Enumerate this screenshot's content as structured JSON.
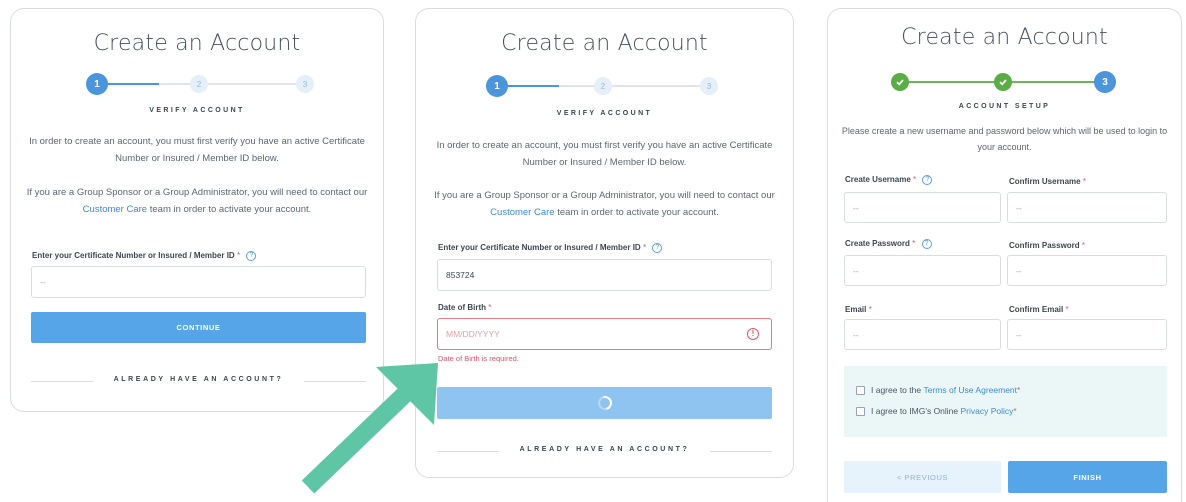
{
  "card1": {
    "title": "Create an Account",
    "steps": [
      "1",
      "2",
      "3"
    ],
    "step_label": "VERIFY ACCOUNT",
    "intro": "In order to create an account, you must first verify you have an active Certificate Number or Insured / Member ID below.",
    "sponsor_text_before": "If you are a Group Sponsor or a Group Administrator, you will need to contact our",
    "customer_care_link": "Customer Care",
    "sponsor_text_after": "team in order to activate your account.",
    "id_label": "Enter your Certificate Number or Insured / Member ID",
    "id_placeholder": "--",
    "continue_label": "CONTINUE",
    "already_label": "ALREADY HAVE AN ACCOUNT?"
  },
  "card2": {
    "title": "Create an Account",
    "steps": [
      "1",
      "2",
      "3"
    ],
    "step_label": "VERIFY ACCOUNT",
    "intro": "In order to create an account, you must first verify you have an active Certificate Number or Insured / Member ID below.",
    "sponsor_text_before": "If you are a Group Sponsor or a Group Administrator, you will need to contact our",
    "customer_care_link": "Customer Care",
    "sponsor_text_after": "team in order to activate your account.",
    "id_label": "Enter your Certificate Number or Insured / Member ID",
    "id_value": "853724",
    "dob_label": "Date of Birth",
    "dob_placeholder": "MM/DD/YYYY",
    "dob_error": "Date of Birth is required.",
    "error_icon_glyph": "!",
    "already_label": "ALREADY HAVE AN ACCOUNT?"
  },
  "card3": {
    "title": "Create an Account",
    "steps": [
      "",
      "",
      "3"
    ],
    "step_label": "ACCOUNT SETUP",
    "intro": "Please create a new username and password below which will be used to login to your account.",
    "create_username_label": "Create Username",
    "confirm_username_label": "Confirm Username",
    "create_password_label": "Create Password",
    "confirm_password_label": "Confirm Password",
    "email_label": "Email",
    "confirm_email_label": "Confirm Email",
    "placeholder": "--",
    "terms_prefix": "I agree to the",
    "terms_link": "Terms of Use Agreement",
    "privacy_prefix": "I agree to IMG's Online",
    "privacy_link": "Privacy Policy",
    "previous_label": "< PREVIOUS",
    "finish_label": "FINISH"
  },
  "common": {
    "required_mark": "*",
    "help_glyph": "?"
  },
  "colors": {
    "primary": "#56a5e8",
    "step_active": "#4a95dc",
    "step_done": "#5aac45",
    "error": "#e0556b",
    "arrow": "#5ec6a4"
  }
}
